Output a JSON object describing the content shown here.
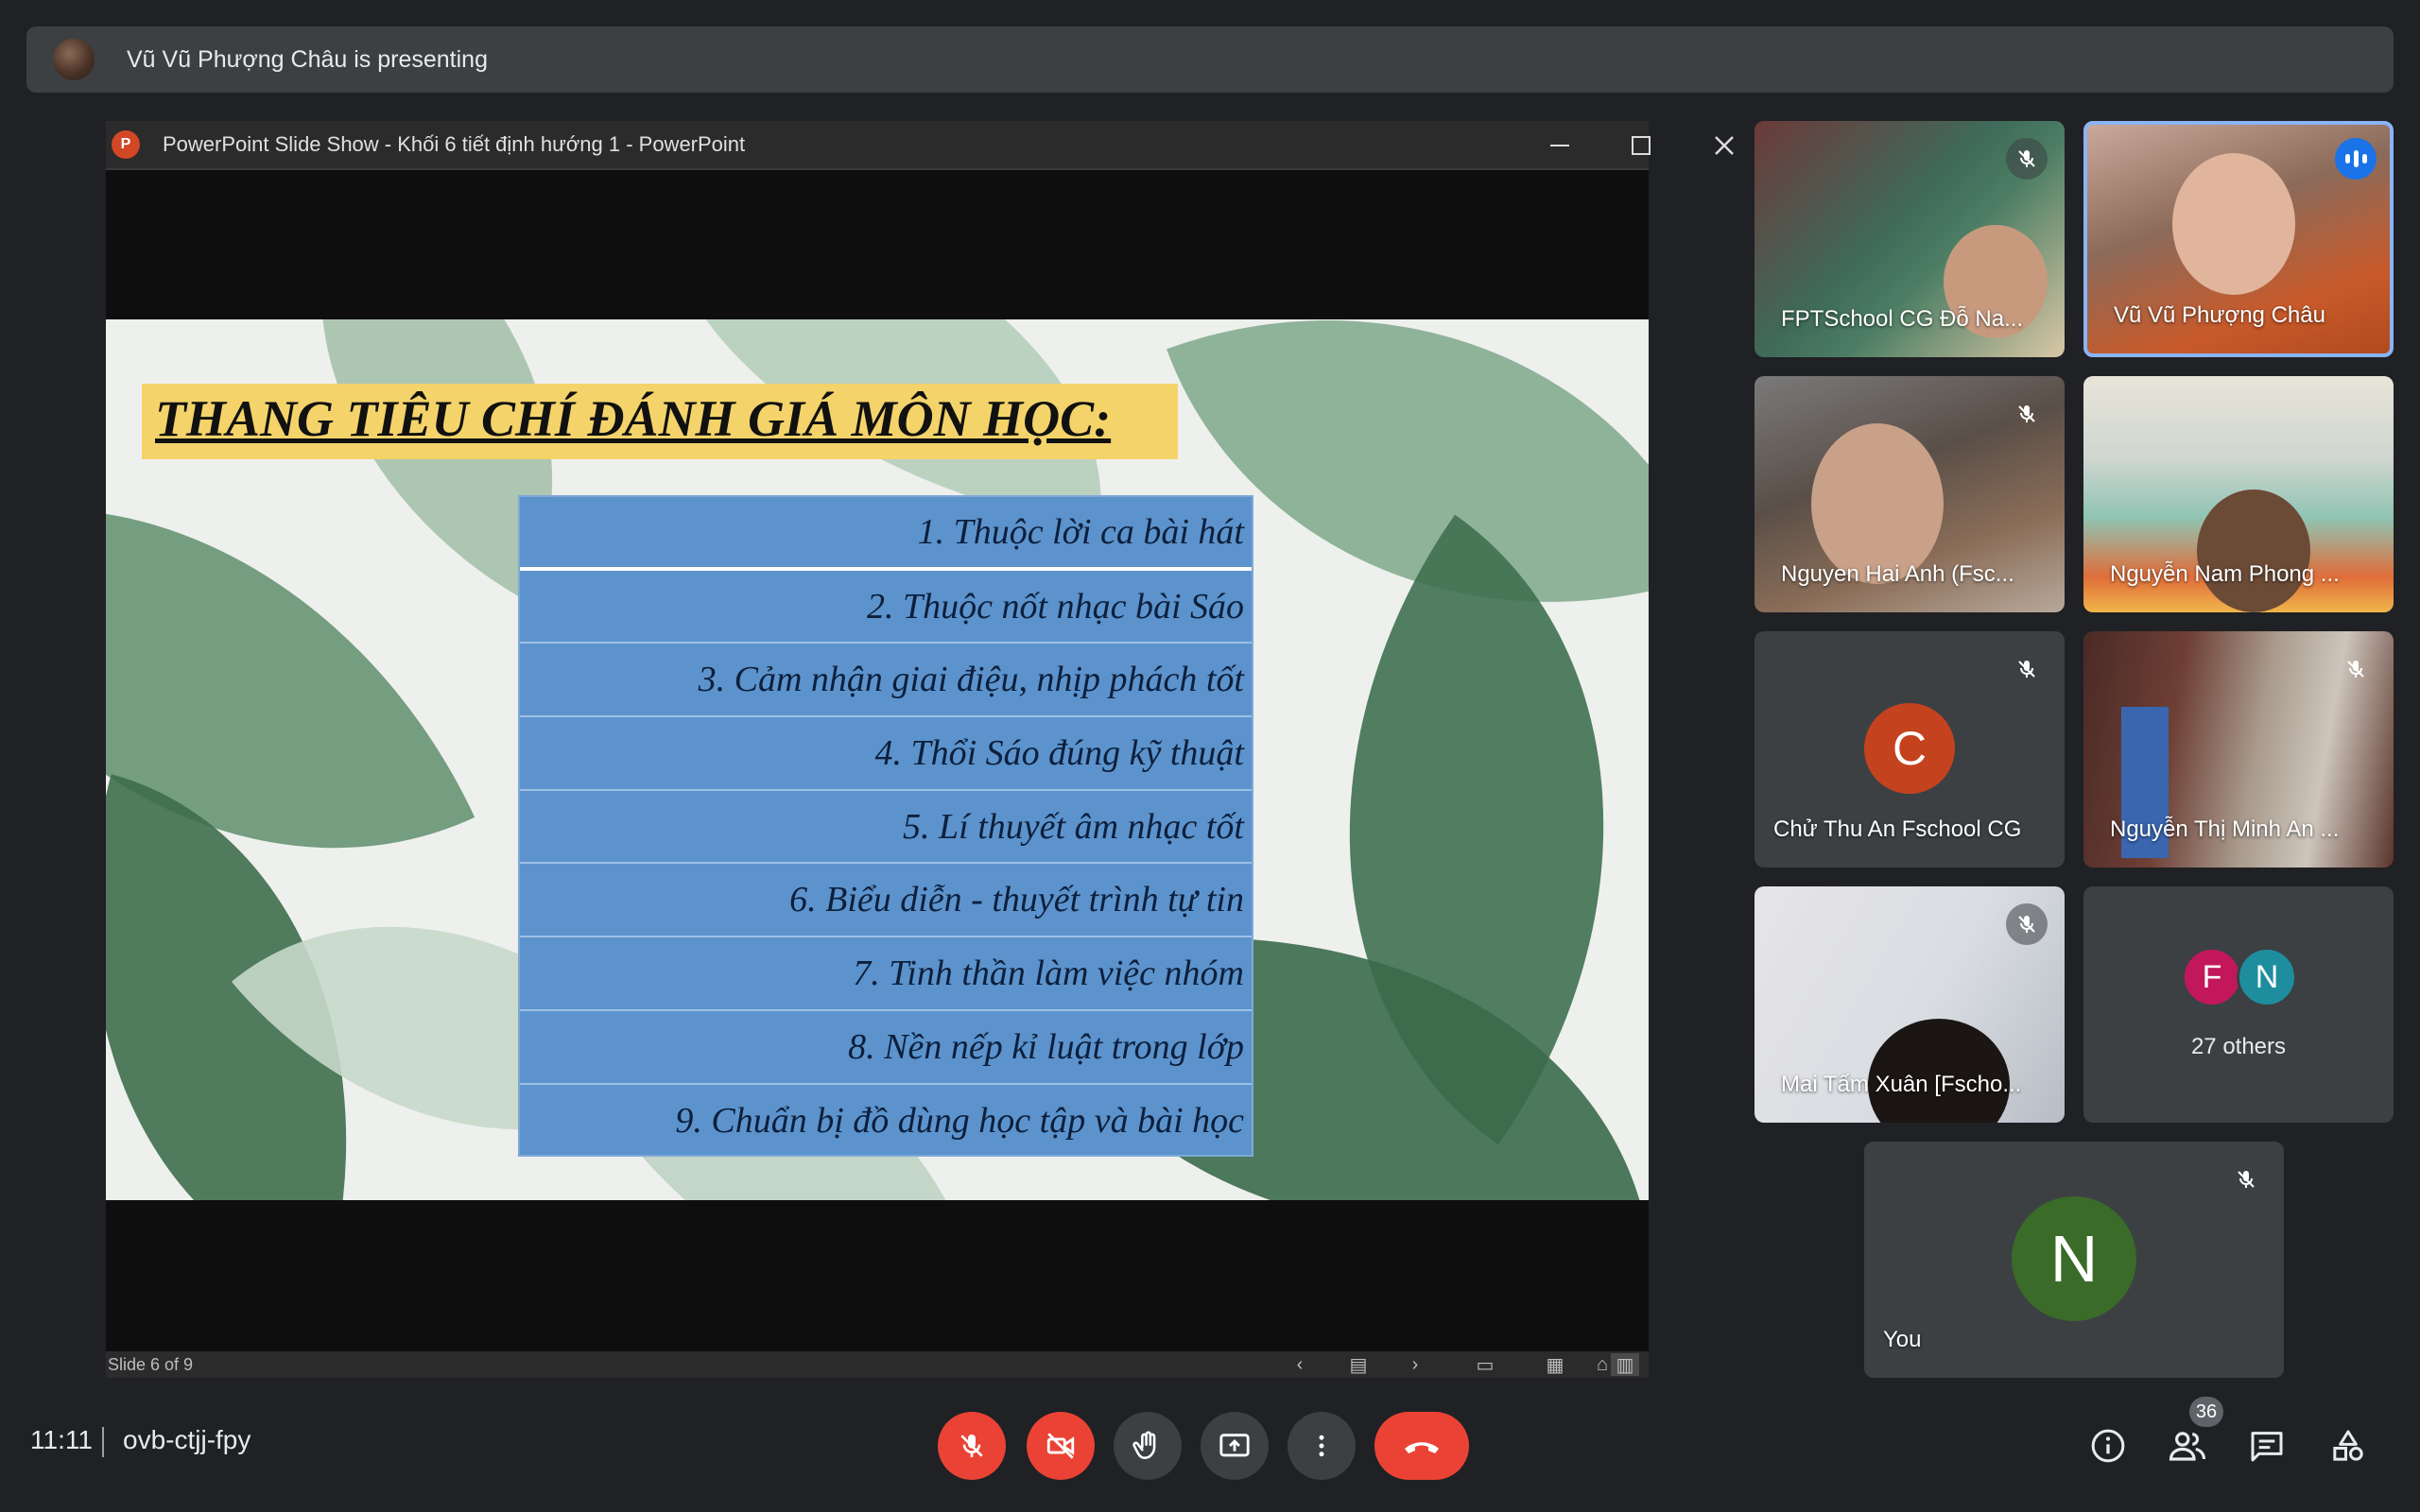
{
  "banner": {
    "presenting_text": "Vũ Vũ Phượng Châu is presenting"
  },
  "ppt_window": {
    "logo_letter": "P",
    "title": "PowerPoint Slide Show  -  Khối 6 tiết định hướng 1 - PowerPoint",
    "status": "Slide 6 of 9"
  },
  "slide": {
    "title": "THANG TIÊU CHÍ ĐÁNH GIÁ MÔN HỌC:",
    "criteria": [
      "1. Thuộc lời ca bài hát",
      "2. Thuộc nốt nhạc bài Sáo",
      "3. Cảm nhận giai điệu, nhịp phách tốt",
      "4. Thổi Sáo đúng kỹ thuật",
      "5. Lí thuyết âm nhạc tốt",
      "6. Biểu diễn - thuyết trình tự tin",
      "7. Tinh thần làm việc nhóm",
      "8. Nền nếp kỉ luật trong lớp",
      "9. Chuẩn bị đồ dùng học tập và bài học"
    ]
  },
  "participants": {
    "p1": {
      "name": "FPTSchool CG Đỗ Na...",
      "muted": true
    },
    "p2": {
      "name": "Vũ Vũ Phượng Châu",
      "speaking": true
    },
    "p3": {
      "name": "Nguyen Hai Anh (Fsc...",
      "muted": true
    },
    "p4": {
      "name": "Nguyễn Nam Phong ..."
    },
    "p5": {
      "name": "Chử Thu An Fschool CG",
      "initial": "C",
      "color": "#c5421e",
      "muted": true
    },
    "p6": {
      "name": "Nguyễn Thị Minh An ...",
      "muted": true
    },
    "p7": {
      "name": "Mai Tấm Xuân [Fscho...",
      "muted": true
    },
    "others": {
      "label": "27 others",
      "a1": "F",
      "a1_color": "#c2185b",
      "a2": "N",
      "a2_color": "#1e8e9e"
    },
    "self": {
      "name": "You",
      "initial": "N",
      "color": "#3a6b28",
      "muted": true
    }
  },
  "bottom": {
    "time": "11:11",
    "meeting_code": "ovb-ctjj-fpy",
    "participant_count": "36"
  },
  "colors": {
    "accent": "#8ab4f8",
    "danger": "#ea4335",
    "background": "#202124"
  }
}
